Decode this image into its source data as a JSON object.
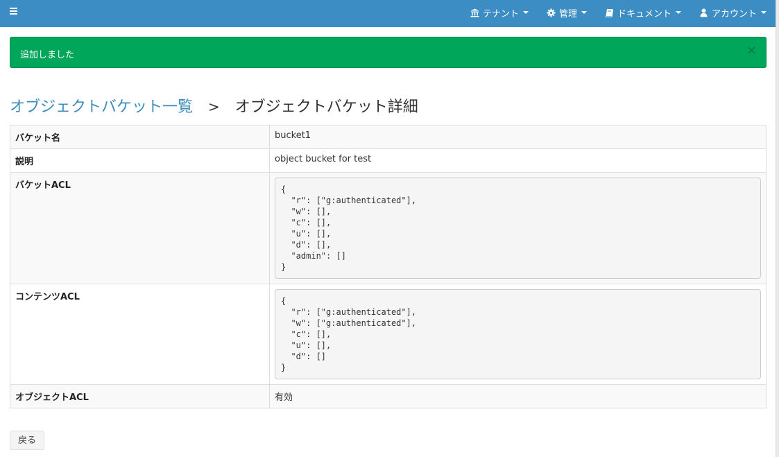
{
  "navbar": {
    "items": [
      {
        "label": "テナント",
        "icon": "bank-icon"
      },
      {
        "label": "管理",
        "icon": "gear-icon"
      },
      {
        "label": "ドキュメント",
        "icon": "book-icon"
      },
      {
        "label": "アカウント",
        "icon": "user-icon"
      }
    ]
  },
  "alert": {
    "message": "追加しました",
    "close": "×"
  },
  "breadcrumb": {
    "parent": "オブジェクトバケット一覧",
    "separator": ">",
    "current": "オブジェクトバケット詳細"
  },
  "detail": {
    "bucket_name_label": "バケット名",
    "bucket_name": "bucket1",
    "description_label": "説明",
    "description": "object bucket for test",
    "bucket_acl_label": "バケットACL",
    "bucket_acl": "{\n  \"r\": [\"g:authenticated\"],\n  \"w\": [],\n  \"c\": [],\n  \"u\": [],\n  \"d\": [],\n  \"admin\": []\n}",
    "contents_acl_label": "コンテンツACL",
    "contents_acl": "{\n  \"r\": [\"g:authenticated\"],\n  \"w\": [\"g:authenticated\"],\n  \"c\": [],\n  \"u\": [],\n  \"d\": []\n}",
    "object_acl_label": "オブジェクトACL",
    "object_acl": "有効"
  },
  "buttons": {
    "back": "戻る"
  },
  "colors": {
    "navbar": "#3c8dc4",
    "alert_success": "#00a65a",
    "link": "#3c8dbc"
  }
}
